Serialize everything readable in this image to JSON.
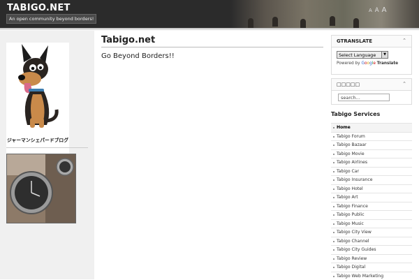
{
  "header": {
    "site_title": "TABIGO.NET",
    "tagline": "An open community beyond borders!",
    "font_resize": [
      "A",
      "A",
      "A"
    ]
  },
  "left_sidebar": {
    "dog_caption": "ジャーマンシェパードブログ"
  },
  "main": {
    "page_title": "Tabigo.net",
    "body_text": "Go Beyond Borders!!"
  },
  "right_sidebar": {
    "gtranslate": {
      "title": "GTRANSLATE",
      "select_value": "Select Language",
      "powered_by_label": "Powered by",
      "google_logo": [
        "G",
        "o",
        "o",
        "g",
        "l",
        "e"
      ],
      "translate_label": "Translate"
    },
    "search_widget": {
      "title": "□□□□□",
      "placeholder": "search..."
    },
    "services": {
      "title": "Tabigo Services",
      "items": [
        "Home",
        "Tabigo Forum",
        "Tabigo Bazaar",
        "Tabigo Movie",
        "Tabigo Airlines",
        "Tabigo Car",
        "Tabigo Insurance",
        "Tabigo Hotel",
        "Tabigo Art",
        "Tabigo Finance",
        "Tabigo Public",
        "Tabigo Music",
        "Tabigo City View",
        "Tabigo Channel",
        "Tabigo City Guides",
        "Tabigo Review",
        "Tabigo Digital",
        "Tabigo Web Marketing"
      ]
    }
  }
}
